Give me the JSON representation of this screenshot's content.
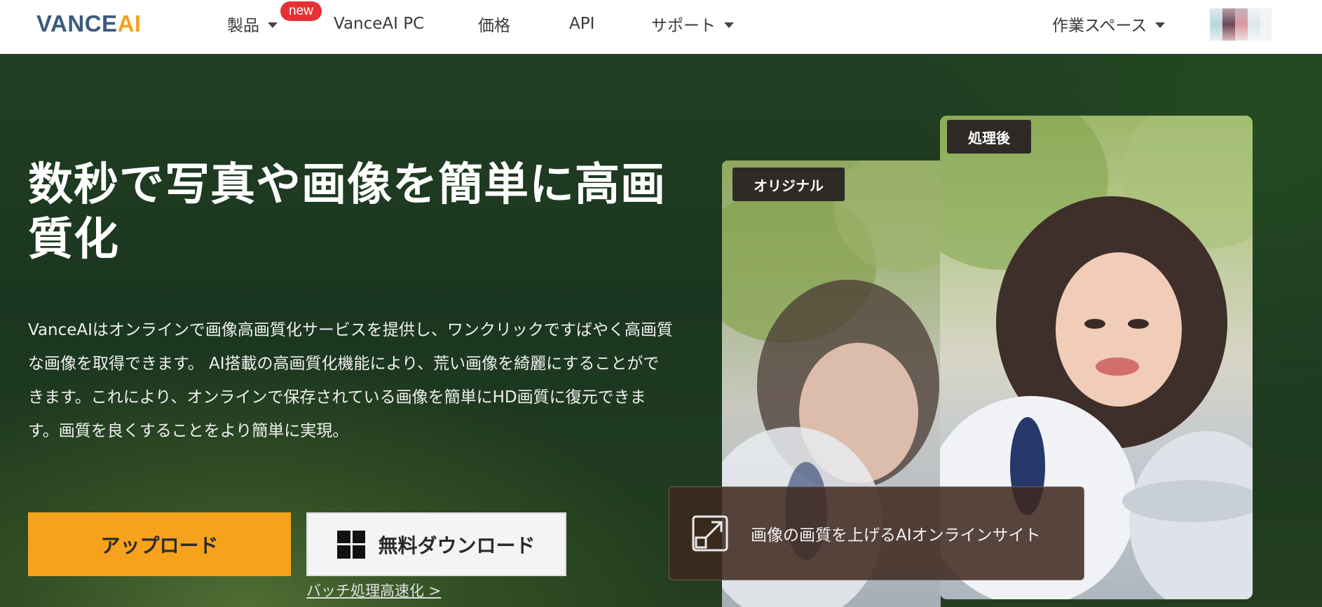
{
  "nav": {
    "logo_part1": "VANCE",
    "logo_part2": "AI",
    "items": [
      {
        "label": "製品"
      },
      {
        "label": "VanceAI PC"
      },
      {
        "label": "価格"
      },
      {
        "label": "API"
      },
      {
        "label": "サポート"
      }
    ],
    "new_badge": "new",
    "workspace": "作業スペース"
  },
  "hero": {
    "title": "数秒で写真や画像を簡単に高画質化",
    "description": "VanceAIはオンラインで画像高画質化サービスを提供し、ワンクリックですばやく高画質な画像を取得できます。 AI搭載の高画質化機能により、荒い画像を綺麗にすることができます。これにより、オンラインで保存されている画像を簡単にHD画質に復元できます。画質を良くすることをより簡単に実現。",
    "upload_button": "アップロード",
    "download_button": "無料ダウンロード",
    "batch_link": "バッチ処理高速化 >",
    "tag_original": "オリジナル",
    "tag_after": "処理後",
    "info_text": "画像の画質を上げるAIオンラインサイト"
  },
  "colors": {
    "accent": "#f7a21d",
    "badge_red": "#e63034",
    "hero_green": "#1e3a1f",
    "logo_blue": "#3c5a7c"
  }
}
